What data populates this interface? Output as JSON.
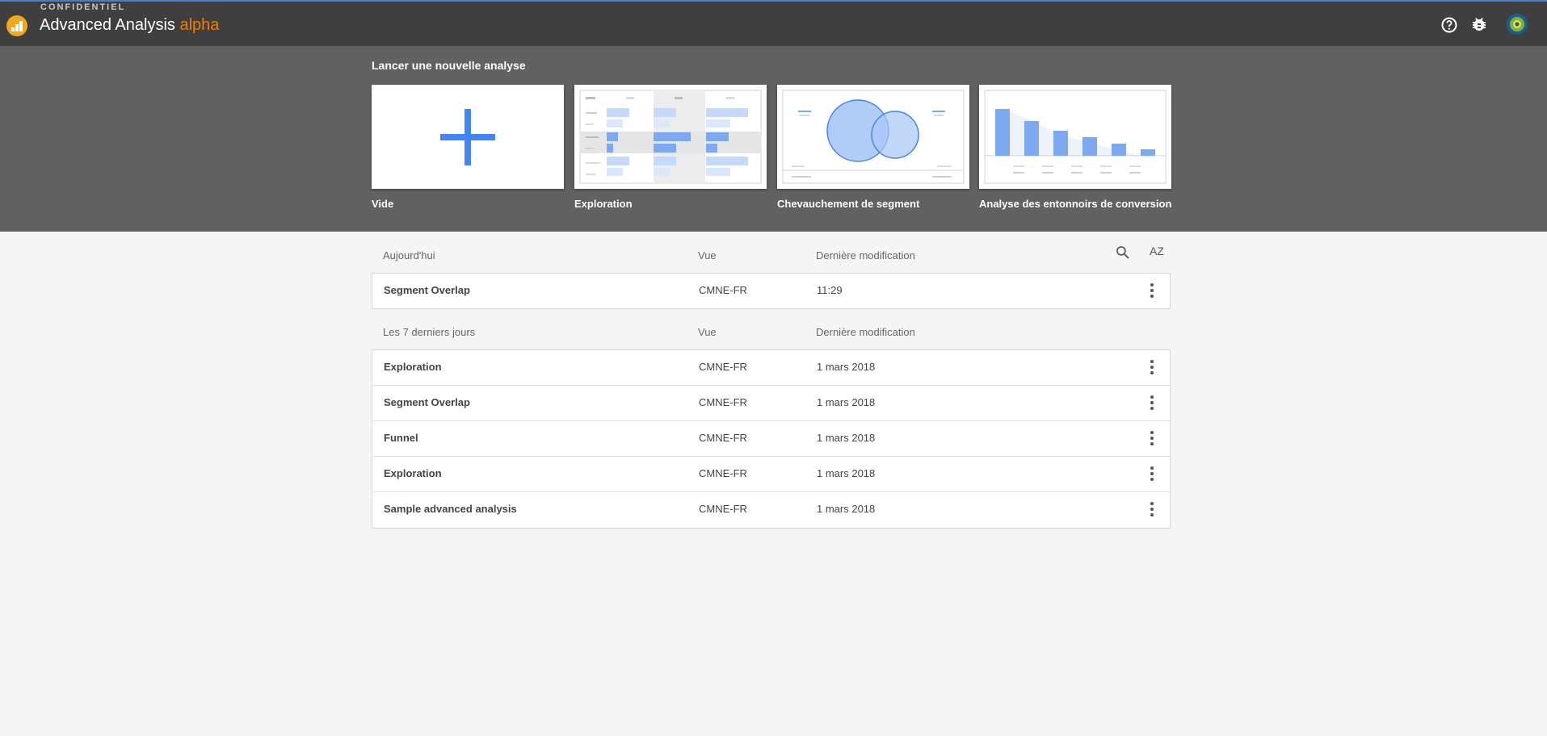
{
  "header": {
    "confidential": "CONFIDENTIEL",
    "title": "Advanced Analysis",
    "alpha": "alpha",
    "icons": [
      "help-icon",
      "bug-icon",
      "avatar"
    ]
  },
  "new_analysis": {
    "title": "Lancer une nouvelle analyse",
    "templates": [
      {
        "label": "Vide"
      },
      {
        "label": "Exploration"
      },
      {
        "label": "Chevauchement de segment"
      },
      {
        "label": "Analyse des entonnoirs de conversion"
      }
    ]
  },
  "today": {
    "heading": "Aujourd'hui",
    "col_view": "Vue",
    "col_modified": "Dernière modification",
    "rows": [
      {
        "name": "Segment Overlap",
        "view": "CMNE-FR",
        "modified": "11:29"
      }
    ]
  },
  "last7": {
    "heading": "Les 7 derniers jours",
    "col_view": "Vue",
    "col_modified": "Dernière modification",
    "rows": [
      {
        "name": "Exploration",
        "view": "CMNE-FR",
        "modified": "1 mars 2018"
      },
      {
        "name": "Segment Overlap",
        "view": "CMNE-FR",
        "modified": "1 mars 2018"
      },
      {
        "name": "Funnel",
        "view": "CMNE-FR",
        "modified": "1 mars 2018"
      },
      {
        "name": "Exploration",
        "view": "CMNE-FR",
        "modified": "1 mars 2018"
      },
      {
        "name": "Sample advanced analysis",
        "view": "CMNE-FR",
        "modified": "1 mars 2018"
      }
    ]
  },
  "sort_label": "AZ",
  "colors": {
    "accent": "#4285f4",
    "alpha": "#f57c00",
    "topbar": "#3f3f3f",
    "hero": "#616161"
  }
}
